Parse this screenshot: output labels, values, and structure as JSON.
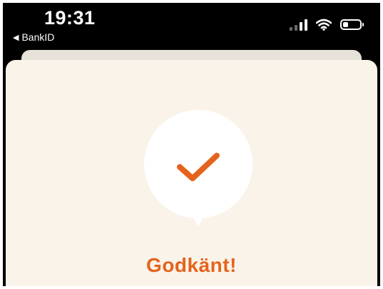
{
  "status_bar": {
    "time": "19:31",
    "back_app_label": "BankID",
    "back_icon": "back-arrow-icon",
    "signal_icon": "cellular-signal-icon",
    "wifi_icon": "wifi-icon",
    "battery_icon": "battery-icon",
    "battery_level": 0.3,
    "signal_bars_active": 2,
    "signal_bars_total": 4
  },
  "result": {
    "icon": "checkmark-icon",
    "title": "Godkänt!"
  },
  "colors": {
    "accent": "#e5631c",
    "sheet_background": "#faf3ea",
    "status_bar_background": "#000000"
  }
}
